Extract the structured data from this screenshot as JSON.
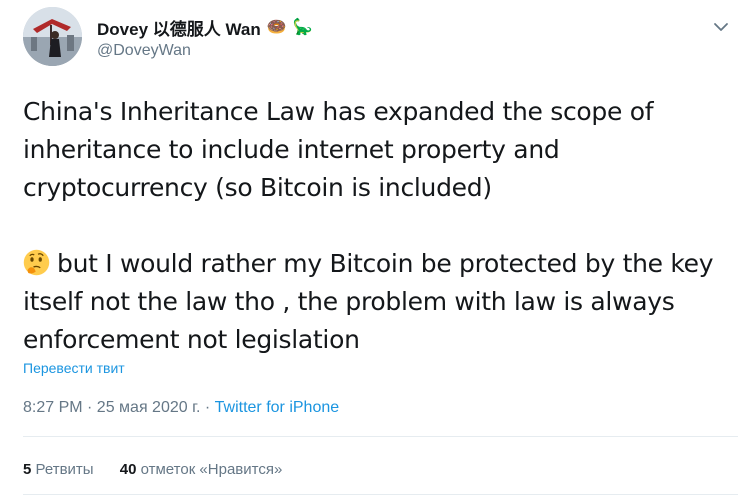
{
  "tweet": {
    "author": {
      "display_name": "Dovey 以德服人 Wan",
      "name_emojis": [
        "🍩",
        "🦕"
      ],
      "handle": "@DoveyWan",
      "avatar_icon": "avatar-photo"
    },
    "paragraph_1": "China's Inheritance Law has expanded the scope of inheritance to include internet property and cryptocurrency (so Bitcoin is included)",
    "paragraph_2_emoji": "thinking-face",
    "paragraph_2": "but I would rather my Bitcoin be protected by the key itself not the law tho , the problem with law is always enforcement not legislation",
    "translate_label": "Перевести твит",
    "timestamp": "8:27 PM · 25 мая 2020 г.",
    "separator": " · ",
    "source": "Twitter for iPhone",
    "retweets_count": "5",
    "retweets_label": "Ретвиты",
    "likes_count": "40",
    "likes_label": "отметок «Нравится»"
  },
  "colors": {
    "link": "#1b95e0",
    "secondary_text": "#657786",
    "primary_text": "#14171a",
    "divider": "#e6ecf0"
  },
  "icons": {
    "menu": "chevron-down-icon"
  }
}
